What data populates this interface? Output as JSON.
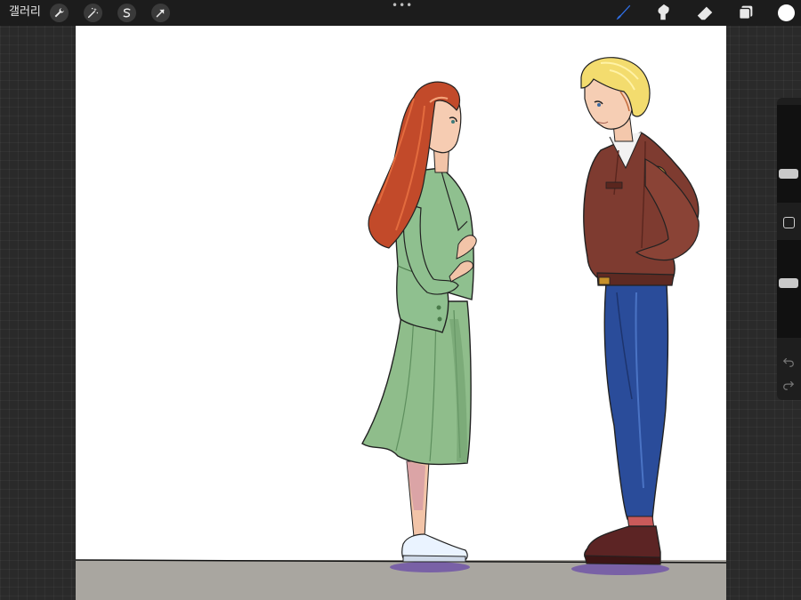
{
  "toolbar": {
    "gallery_label": "갤러리",
    "more_label": "•••",
    "left_tools": [
      {
        "name": "actions-wrench-icon"
      },
      {
        "name": "adjustments-magic-wand-icon"
      },
      {
        "name": "selection-s-icon"
      },
      {
        "name": "transform-arrow-icon"
      }
    ],
    "right_tools": [
      {
        "name": "brush-icon",
        "active": true
      },
      {
        "name": "smudge-icon",
        "active": false
      },
      {
        "name": "eraser-icon",
        "active": false
      },
      {
        "name": "layers-icon",
        "active": false
      }
    ],
    "current_color": "#ffffff",
    "accent_color": "#2f6fe6"
  },
  "sidebar": {
    "brush_size": 0.27,
    "brush_opacity": 0.57,
    "modify_icon": "square-modify-icon",
    "undo_icon": "undo-icon",
    "redo_icon": "redo-icon"
  },
  "canvas": {
    "background": "#ffffff",
    "floor_color": "#a9a6a0",
    "subject": "illustration"
  }
}
